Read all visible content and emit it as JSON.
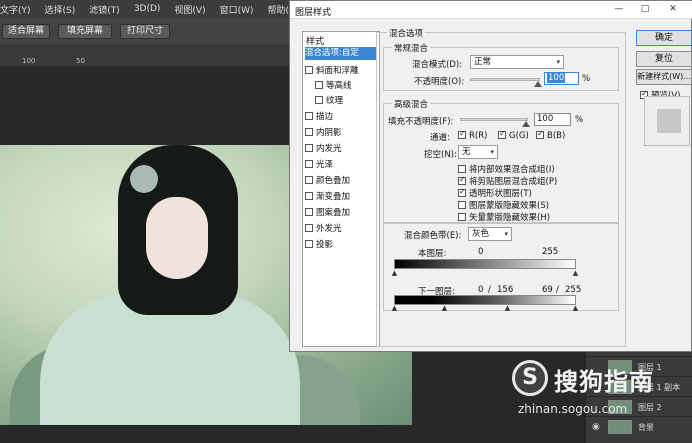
{
  "ps": {
    "menu": [
      "文字(Y)",
      "选择(S)",
      "滤镜(T)",
      "3D(D)",
      "视图(V)",
      "窗口(W)",
      "帮助(H)"
    ],
    "options": [
      "适合屏幕",
      "填充屏幕",
      "打印尺寸"
    ],
    "ruler": [
      "100",
      "50"
    ]
  },
  "layers_panel": {
    "rows": [
      {
        "name": "图层 1"
      },
      {
        "name": "图层 1 副本"
      },
      {
        "name": "图层 2"
      },
      {
        "name": "背景"
      }
    ]
  },
  "watermark": {
    "logo": "S",
    "brand": "搜狗指南",
    "url": "zhinan.sogou.com"
  },
  "dialog": {
    "title": "图层样式",
    "styles_header": "样式",
    "style_items": [
      {
        "label": "混合选项:自定",
        "checkbox": false,
        "selected": true,
        "indent": 0
      },
      {
        "label": "斜面和浮雕",
        "checkbox": true,
        "indent": 0
      },
      {
        "label": "等高线",
        "checkbox": true,
        "indent": 1
      },
      {
        "label": "纹理",
        "checkbox": true,
        "indent": 1
      },
      {
        "label": "描边",
        "checkbox": true,
        "indent": 0
      },
      {
        "label": "内阴影",
        "checkbox": true,
        "indent": 0
      },
      {
        "label": "内发光",
        "checkbox": true,
        "indent": 0
      },
      {
        "label": "光泽",
        "checkbox": true,
        "indent": 0
      },
      {
        "label": "颜色叠加",
        "checkbox": true,
        "indent": 0
      },
      {
        "label": "渐变叠加",
        "checkbox": true,
        "indent": 0
      },
      {
        "label": "图案叠加",
        "checkbox": true,
        "indent": 0
      },
      {
        "label": "外发光",
        "checkbox": true,
        "indent": 0
      },
      {
        "label": "投影",
        "checkbox": true,
        "indent": 0
      }
    ],
    "blending_options": "混合选项",
    "general_blending": "常规混合",
    "blend_mode_label": "混合模式(D):",
    "blend_mode_value": "正常",
    "opacity_label": "不透明度(O):",
    "opacity_value": "100",
    "percent": "%",
    "advanced_blending": "高级混合",
    "fill_opacity_label": "填充不透明度(F):",
    "fill_opacity_value": "100",
    "channels_label": "通道:",
    "channels": [
      {
        "label": "R(R)",
        "checked": true
      },
      {
        "label": "G(G)",
        "checked": true
      },
      {
        "label": "B(B)",
        "checked": true
      }
    ],
    "knockout_label": "挖空(N):",
    "knockout_value": "无",
    "advanced_checks": [
      {
        "label": "将内部效果混合成组(I)",
        "checked": false
      },
      {
        "label": "将剪贴图层混合成组(P)",
        "checked": true
      },
      {
        "label": "透明形状图层(T)",
        "checked": true
      },
      {
        "label": "图层蒙版隐藏效果(S)",
        "checked": false
      },
      {
        "label": "矢量蒙版隐藏效果(H)",
        "checked": false
      }
    ],
    "blend_if_label": "混合颜色带(E):",
    "blend_if_value": "灰色",
    "this_layer_label": "本图层:",
    "this_layer_values": [
      "0",
      "255"
    ],
    "underlying_label": "下一图层:",
    "underlying_values": [
      "0",
      "/",
      "156",
      "69",
      "/",
      "255"
    ],
    "buttons": {
      "ok": "确定",
      "reset": "复位",
      "new_style": "新建样式(W)...",
      "preview": "预览(V)"
    },
    "preview_checked": true,
    "title_controls": [
      "—",
      "□",
      "✕"
    ]
  }
}
